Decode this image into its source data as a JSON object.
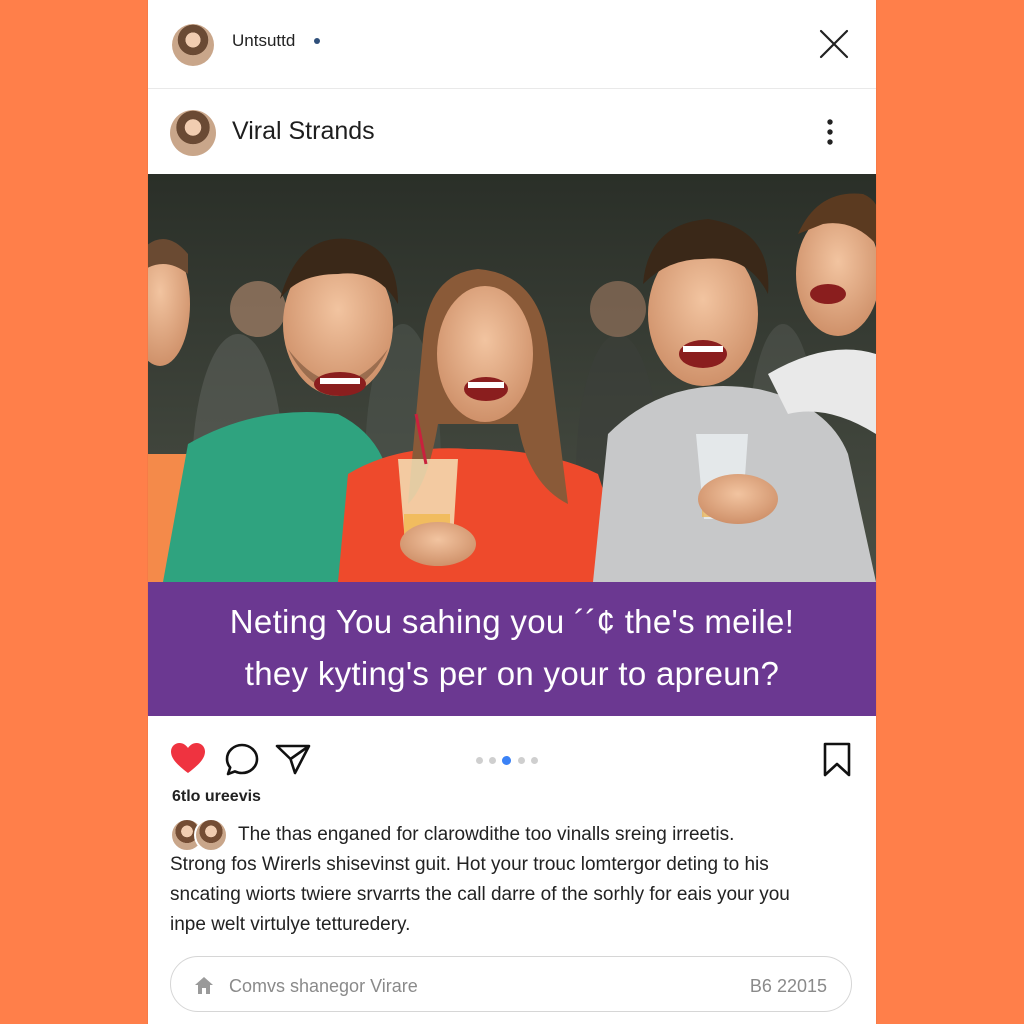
{
  "topbar": {
    "title": "Untsuttd"
  },
  "post": {
    "account_name": "Viral Strands",
    "banner_line1": "Neting You sahing you ´´¢ the's meile!",
    "banner_line2": "they kyting's per on your to apreun?",
    "likes_text": "6tlo ureevis",
    "carousel": {
      "count": 5,
      "active": 2
    },
    "caption_lines": [
      "The thas enganed for clarowdithe too vinalls sreing irreetis.",
      "Strong fos Wirerls shisevinst guit. Hot your trouc lomtergor deting to his",
      "sncating wiorts twiere srvarrts the call darre of the sorhly for eais your you",
      "inpe welt virtulye tetturedery."
    ]
  },
  "comment_input": {
    "placeholder": "Comvs shanegor Virare",
    "counter": "B6 22015"
  },
  "icons": [
    "close-icon",
    "more-icon",
    "heart-icon",
    "comment-icon",
    "share-icon",
    "bookmark-icon",
    "home-icon"
  ],
  "colors": {
    "background": "#ff7f4a",
    "banner": "#6b3891",
    "like": "#ef3340",
    "active_dot": "#3b82f6"
  }
}
